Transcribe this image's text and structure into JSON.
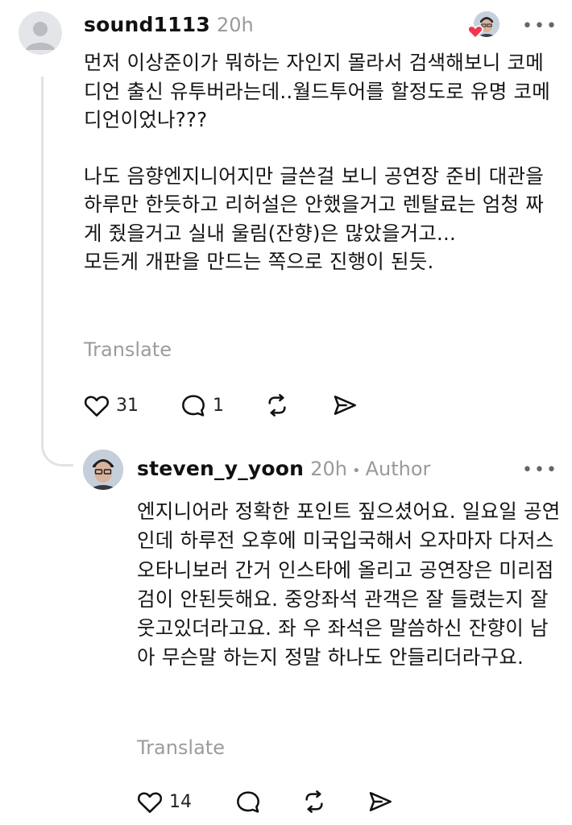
{
  "comment": {
    "username": "sound1113",
    "time": "20h",
    "paragraphs": [
      "먼저 이상준이가 뭐하는 자인지 몰라서  검색해보니 코메디언 출신 유투버라는데..월드투어를 할정도로 유명 코메디언이었나???",
      "나도 음향엔지니어지만 글쓴걸 보니 공연장 준비 대관을 하루만 한듯하고 리허설은 안했을거고 렌탈료는 엄청 짜게 줬을거고 실내 울림(잔향)은 많았을거고...\n모든게 개판을 만드는 쪽으로 진행이 된듯."
    ],
    "translate": "Translate",
    "likes": "31",
    "replies": "1",
    "liked_by_author": true
  },
  "reply": {
    "username": "steven_y_yoon",
    "time": "20h",
    "separator": "•",
    "badge": "Author",
    "text": "엔지니어라 정확한 포인트 짚으셨어요. 일요일 공연인데 하루전 오후에 미국입국해서 오자마자 다저스 오타니보러 간거 인스타에 올리고 공연장은 미리점검이 안된듯해요. 중앙좌석 관객은 잘 들렸는지 잘 웃고있더라고요. 좌 우 좌석은 말씀하신 잔향이 남아 무슨말 하는지 정말 하나도 안들리더라구요.",
    "translate": "Translate",
    "likes": "14"
  },
  "more_label": "•••",
  "colors": {
    "heart_badge": "#f0364f",
    "muted": "#9a9a9a",
    "thread": "#e2e2e2"
  },
  "icons": [
    "heart-icon",
    "comment-icon",
    "repost-icon",
    "share-icon",
    "more-icon",
    "default-avatar-icon"
  ]
}
